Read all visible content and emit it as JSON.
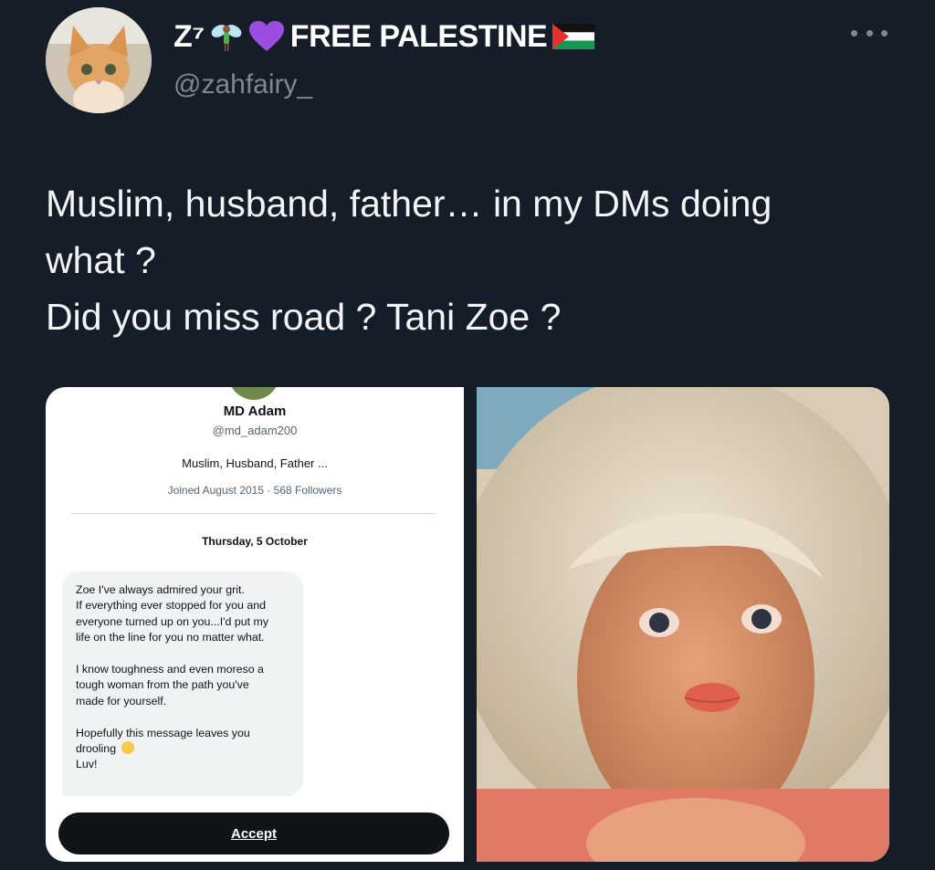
{
  "author": {
    "display_name": "Z⁷",
    "name_badge": "FREE PALESTINE",
    "handle": "@zahfairy_"
  },
  "tweet": {
    "lines": [
      "Muslim, husband, father… in my DMs doing",
      "what ?",
      "Did you miss road ? Tani Zoe ?"
    ]
  },
  "dm_screenshot": {
    "name": "MD Adam",
    "handle": "@md_adam200",
    "bio": "Muslim, Husband, Father ...",
    "meta": "Joined August 2015 · 568 Followers",
    "date": "Thursday, 5 October",
    "message_lines": [
      "Zoe I've always admired your grit.",
      "If everything ever stopped for you and",
      "everyone turned up on you...I'd put my",
      "life on the line for you no matter what.",
      "",
      "I know toughness and even moreso a",
      "tough woman from the path you've",
      "made for yourself.",
      "",
      "Hopefully this message leaves you",
      "drooling",
      "Luv!"
    ],
    "accept_label": "Accept"
  },
  "icons": [
    "fairy-emoji-icon",
    "purple-heart-icon",
    "palestine-flag-icon",
    "more-options-icon",
    "drooling-face-emoji-icon"
  ],
  "colors": {
    "background": "#151d28",
    "text": "#e7e9ea",
    "muted": "#7f8790"
  }
}
